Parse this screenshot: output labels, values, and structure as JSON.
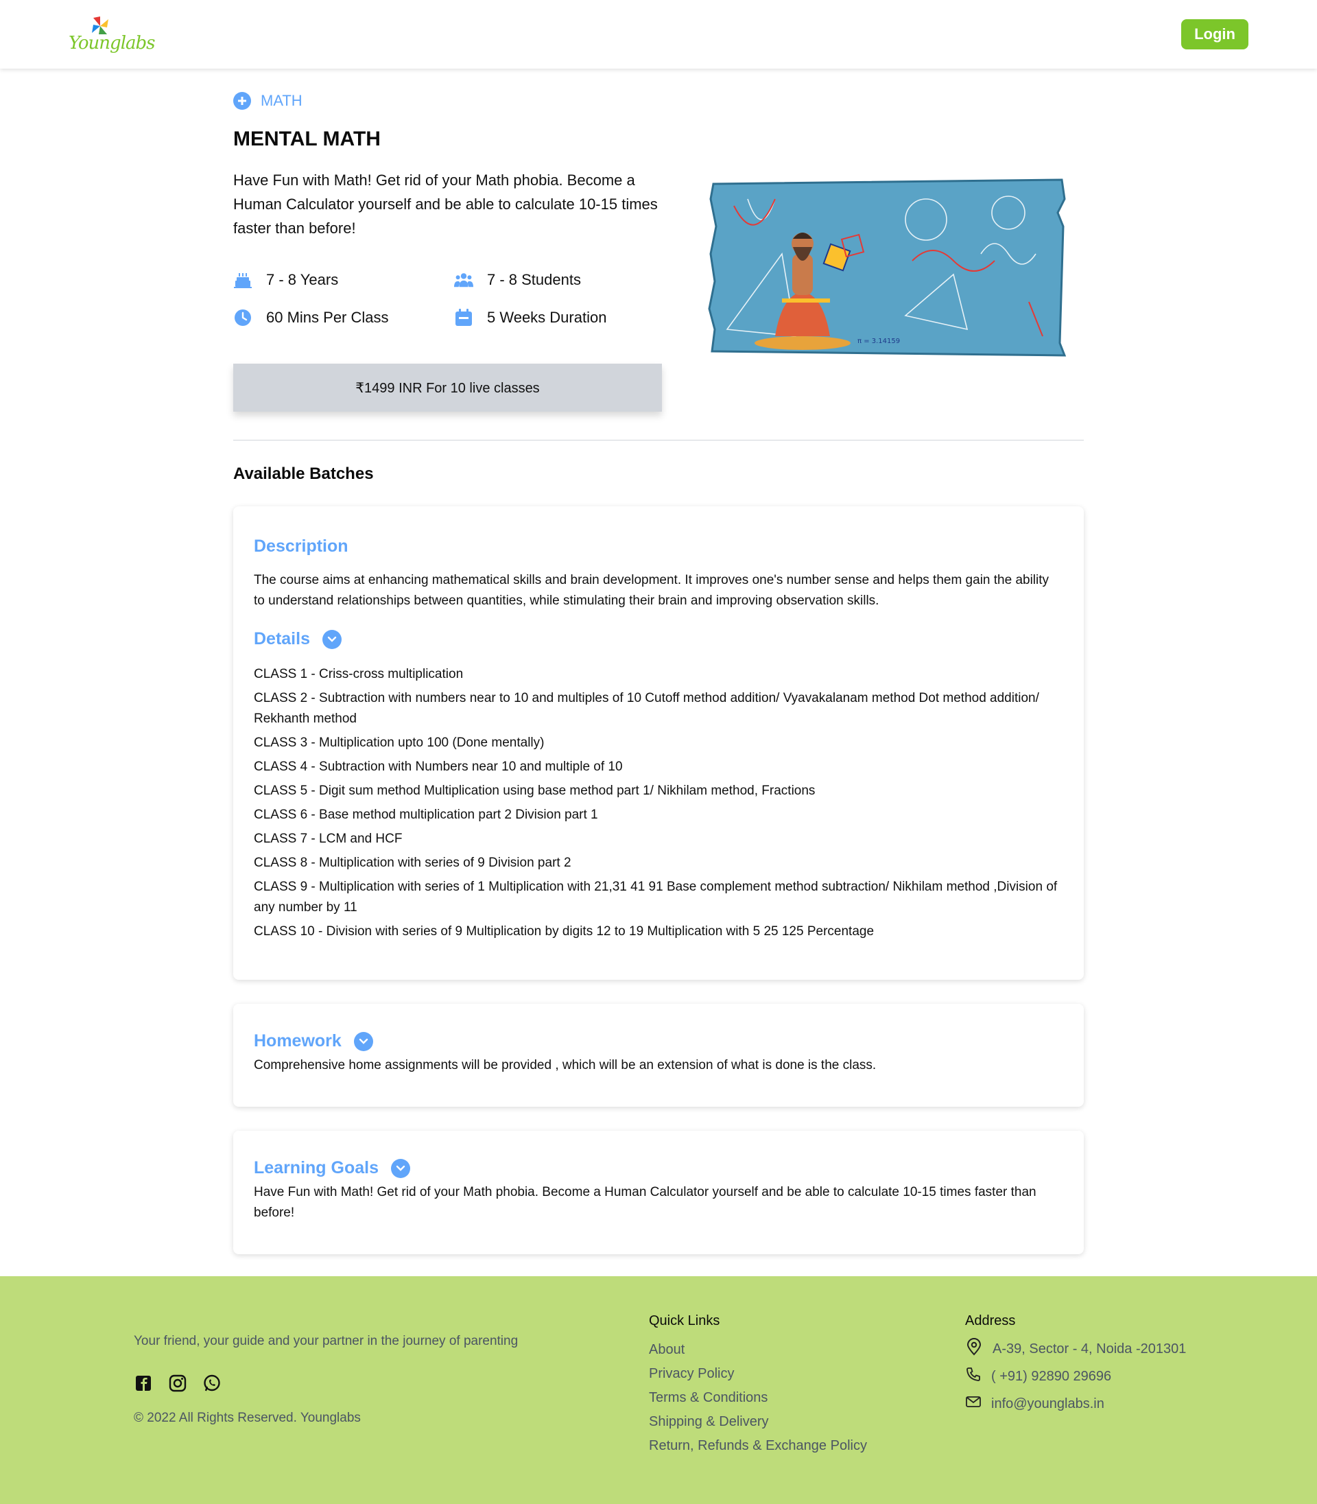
{
  "header": {
    "logo_text": "Younglabs",
    "login_label": "Login"
  },
  "course": {
    "category": "MATH",
    "title": "MENTAL MATH",
    "tagline": "Have Fun with Math! Get rid of your Math phobia. Become a Human Calculator yourself and be able to calculate 10-15 times faster than before!",
    "age": "7 - 8 Years",
    "students": "7 - 8 Students",
    "class_length": "60 Mins Per Class",
    "duration": "5 Weeks Duration",
    "price": "₹1499 INR For 10 live classes"
  },
  "batches_heading": "Available Batches",
  "description": {
    "heading": "Description",
    "text": "The course aims at enhancing mathematical skills and brain development. It improves one's number sense and helps them gain the ability to understand relationships between quantities, while stimulating their brain and improving observation skills."
  },
  "details": {
    "heading": "Details",
    "classes": [
      "CLASS 1 - Criss-cross multiplication",
      "CLASS 2 - Subtraction with numbers near to 10 and multiples of 10 Cutoff method addition/ Vyavakalanam method Dot method addition/ Rekhanth method",
      "CLASS 3 - Multiplication upto 100 (Done mentally)",
      "CLASS 4 - Subtraction with Numbers near 10 and multiple of 10",
      "CLASS 5 - Digit sum method Multiplication using base method part 1/ Nikhilam method, Fractions",
      "CLASS 6 - Base method multiplication part 2 Division part 1",
      "CLASS 7 - LCM and HCF",
      "CLASS 8 - Multiplication with series of 9 Division part 2",
      "CLASS 9 - Multiplication with series of 1 Multiplication with 21,31 41 91 Base complement method subtraction/ Nikhilam method ,Division of any number by 11",
      "CLASS 10 - Division with series of 9 Multiplication by digits 12 to 19 Multiplication with 5 25 125 Percentage"
    ]
  },
  "homework": {
    "heading": "Homework",
    "text": "Comprehensive home assignments will be provided , which will be an extension of what is done is the class."
  },
  "learning_goals": {
    "heading": "Learning Goals",
    "text": "Have Fun with Math! Get rid of your Math phobia. Become a Human Calculator yourself and be able to calculate 10-15 times faster than before!"
  },
  "footer": {
    "tagline": "Your friend, your guide and your partner in the journey of parenting",
    "copyright": "© 2022 All Rights Reserved. Younglabs",
    "quick_links_title": "Quick Links",
    "quick_links": [
      "About",
      "Privacy Policy",
      "Terms & Conditions",
      "Shipping & Delivery",
      "Return, Refunds & Exchange Policy"
    ],
    "address_title": "Address",
    "address": "A-39, Sector - 4, Noida -201301",
    "phone": "( +91) 92890 29696",
    "email": "info@younglabs.in"
  },
  "colors": {
    "accent_blue": "#60a5fa",
    "brand_green": "#7cc62a",
    "footer_bg": "#bedc7a"
  }
}
